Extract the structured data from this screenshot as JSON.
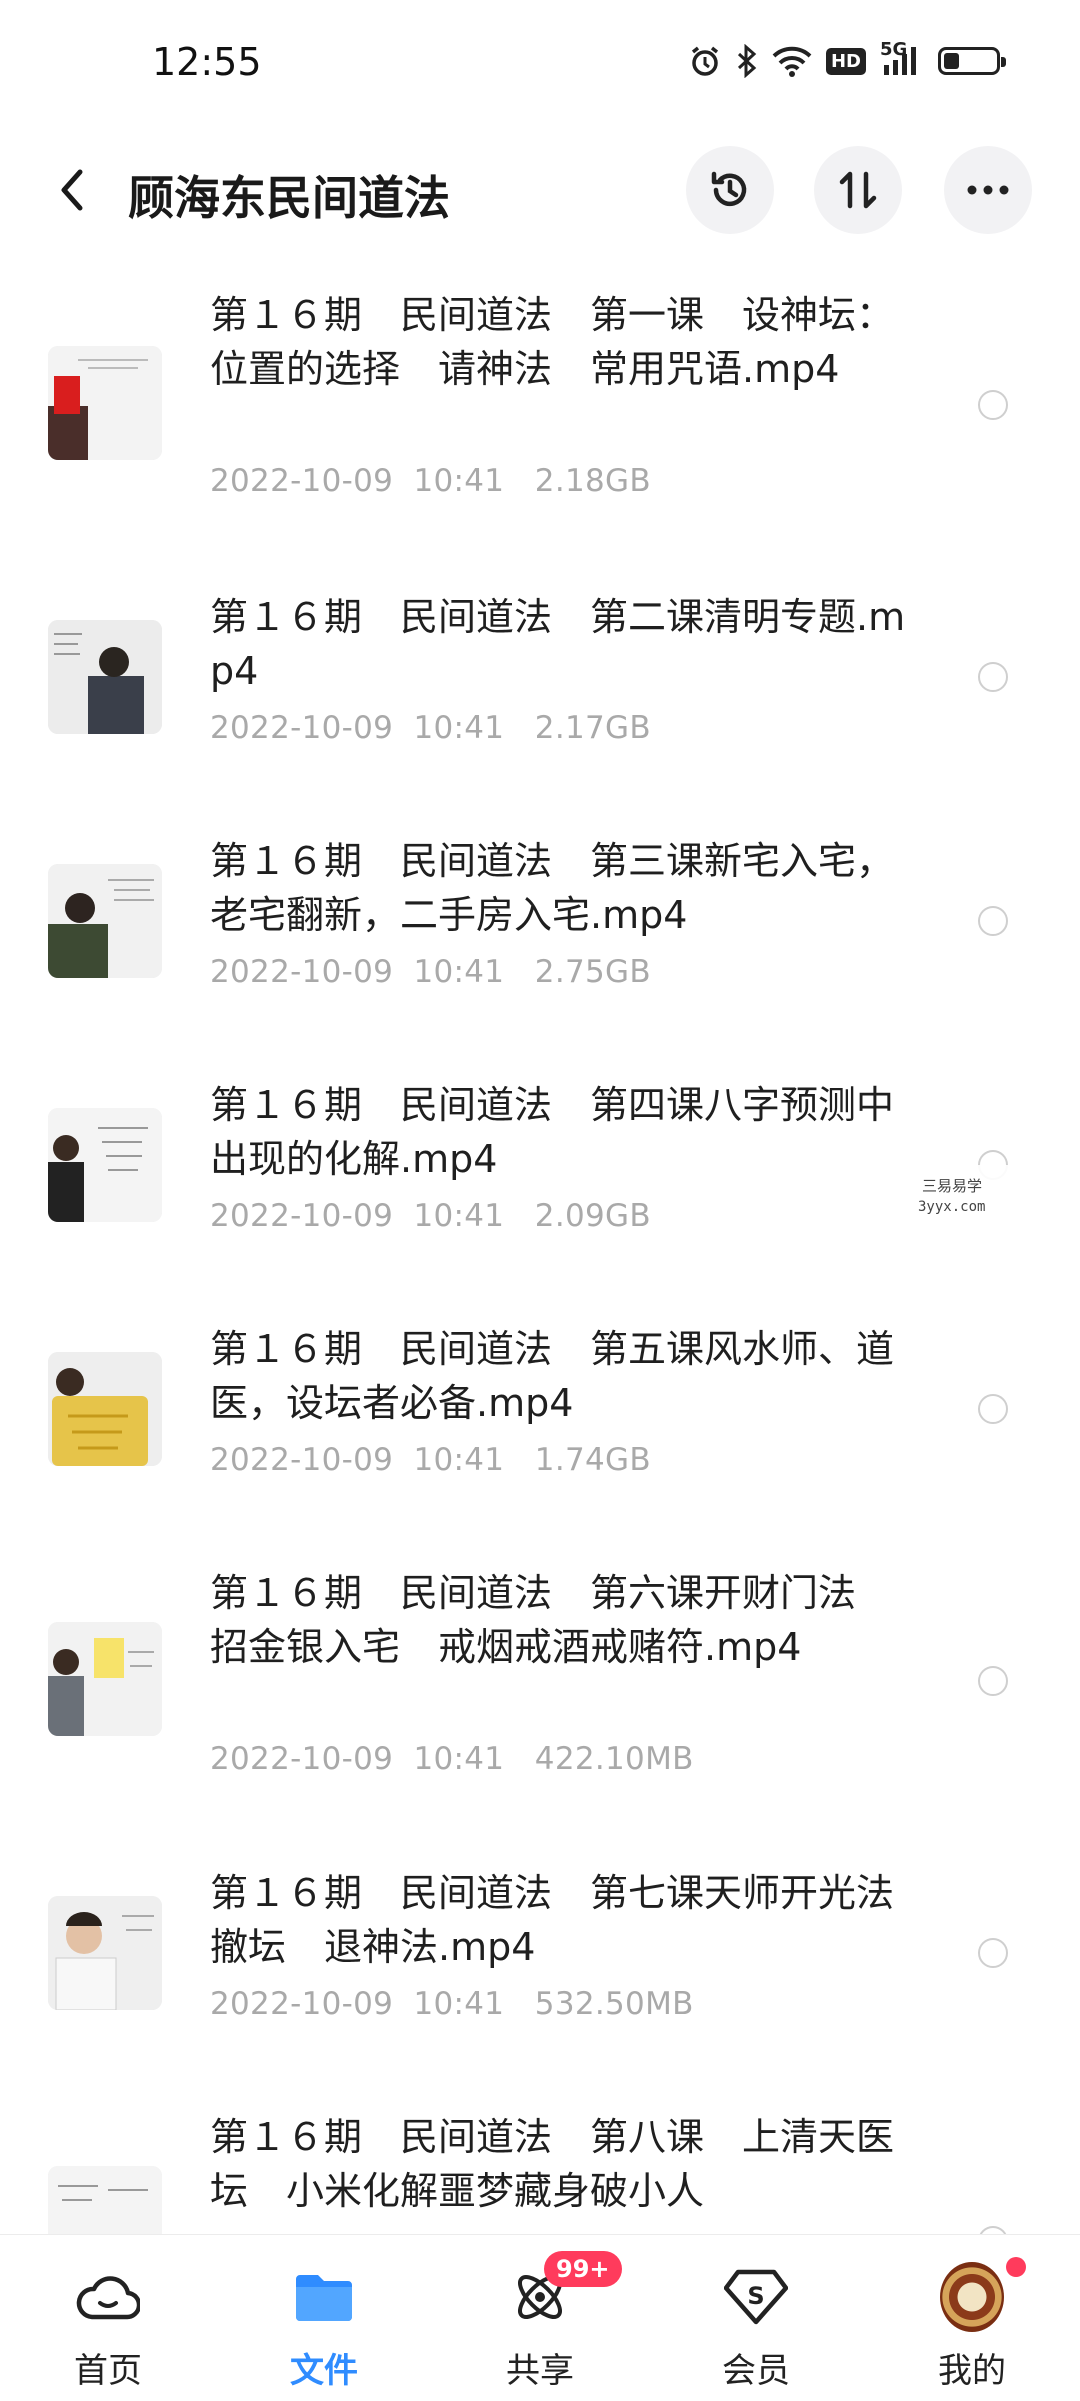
{
  "status_bar": {
    "time": "12:55",
    "icons": [
      "alarm-icon",
      "bluetooth-icon",
      "wifi-icon",
      "hd-icon",
      "5g-signal-icon",
      "battery-icon"
    ],
    "hd_label": "HD",
    "network_label": "5G",
    "battery_level": 0.3
  },
  "header": {
    "title": "顾海东民间道法",
    "actions": [
      "history-icon",
      "sort-icon",
      "more-icon"
    ]
  },
  "files": [
    {
      "name": "第１６期　民间道法　第一课　设神坛：位置的选择　请神法　常用咒语.mp4",
      "date": "2022-10-09",
      "time": "10:41",
      "size": "2.18GB"
    },
    {
      "name": "第１６期　民间道法　第二课清明专题.mp4",
      "date": "2022-10-09",
      "time": "10:41",
      "size": "2.17GB"
    },
    {
      "name": "第１６期　民间道法　第三课新宅入宅，老宅翻新，二手房入宅.mp4",
      "date": "2022-10-09",
      "time": "10:41",
      "size": "2.75GB"
    },
    {
      "name": "第１６期　民间道法　第四课八字预测中出现的化解.mp4",
      "date": "2022-10-09",
      "time": "10:41",
      "size": "2.09GB"
    },
    {
      "name": "第１６期　民间道法　第五课风水师、道医，设坛者必备.mp4",
      "date": "2022-10-09",
      "time": "10:41",
      "size": "1.74GB"
    },
    {
      "name": "第１６期　民间道法　第六课开财门法　招金银入宅　戒烟戒酒戒赌符.mp4",
      "date": "2022-10-09",
      "time": "10:41",
      "size": "422.10MB"
    },
    {
      "name": "第１６期　民间道法　第七课天师开光法　撤坛　退神法.mp4",
      "date": "2022-10-09",
      "time": "10:41",
      "size": "532.50MB"
    },
    {
      "name": "第１６期　民间道法　第八课　上清天医坛　小米化解噩梦藏身破小人",
      "date": "",
      "time": "",
      "size": ""
    }
  ],
  "watermark": {
    "line1": "三易易学",
    "line2": "3yyx.com"
  },
  "bottom_nav": [
    {
      "label": "首页",
      "icon": "cloud-home-icon",
      "active": false
    },
    {
      "label": "文件",
      "icon": "folder-icon",
      "active": true
    },
    {
      "label": "共享",
      "icon": "share-orbit-icon",
      "active": false,
      "badge": "99+"
    },
    {
      "label": "会员",
      "icon": "vip-diamond-icon",
      "active": false
    },
    {
      "label": "我的",
      "icon": "avatar",
      "active": false,
      "dot": true
    }
  ],
  "colors": {
    "accent": "#2f8cff",
    "badge": "#ff3b5c",
    "meta_text": "#a9a9a9"
  }
}
